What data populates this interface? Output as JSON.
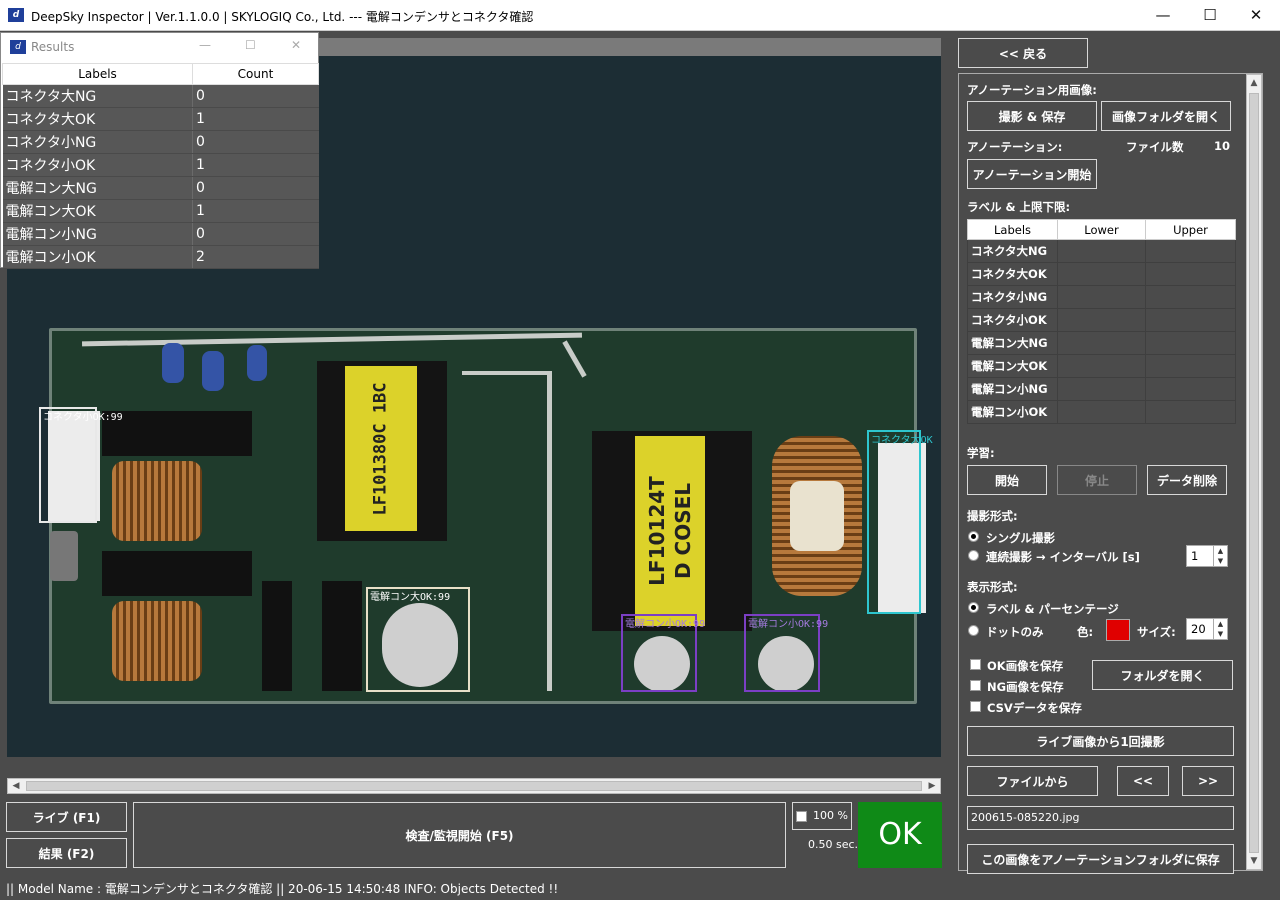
{
  "window": {
    "title": "DeepSky Inspector | Ver.1.1.0.0 | SKYLOGIQ Co., Ltd. --- 電解コンデンサとコネクタ確認",
    "minimize": "—",
    "maximize": "☐",
    "close": "✕"
  },
  "results": {
    "title": "Results",
    "headers": {
      "labels": "Labels",
      "count": "Count"
    },
    "rows": [
      {
        "label": "コネクタ大NG",
        "count": "0"
      },
      {
        "label": "コネクタ大OK",
        "count": "1"
      },
      {
        "label": "コネクタ小NG",
        "count": "0"
      },
      {
        "label": "コネクタ小OK",
        "count": "1"
      },
      {
        "label": "電解コン大NG",
        "count": "0"
      },
      {
        "label": "電解コン大OK",
        "count": "1"
      },
      {
        "label": "電解コン小NG",
        "count": "0"
      },
      {
        "label": "電解コン小OK",
        "count": "2"
      }
    ]
  },
  "detections": [
    {
      "label": "コネクタ小OK:99",
      "color": "#e8e8e8"
    },
    {
      "label": "コネクタ大OK",
      "color": "#2ec6cf"
    },
    {
      "label": "電解コン大OK:99",
      "color": "#e8e0c8"
    },
    {
      "label": "電解コン小OK:99",
      "color": "#7b3fc4"
    },
    {
      "label": "電解コン小OK:99",
      "color": "#7b3fc4"
    }
  ],
  "board_print": {
    "coil1": "LF101380C 1BC",
    "coil2a": "LF10124T",
    "coil2b": "D COSEL"
  },
  "controls": {
    "live": "ライブ (F1)",
    "result": "結果 (F2)",
    "inspect": "検査/監視開始 (F5)",
    "zoom": "100 %",
    "time": "0.50 sec.",
    "verdict": "OK",
    "verdict_color": "#0f8a17"
  },
  "panel": {
    "back": "<< 戻る",
    "annot_image": "アノーテーション用画像:",
    "shoot_save": "撮影 & 保存",
    "open_img_folder": "画像フォルダを開く",
    "annotation": "アノーテーション:",
    "file_count_label": "ファイル数",
    "file_count": "10",
    "annot_start": "アノーテーション開始",
    "label_limits": "ラベル & 上限下限:",
    "lim_headers": {
      "labels": "Labels",
      "lower": "Lower",
      "upper": "Upper"
    },
    "lim_rows": [
      "コネクタ大NG",
      "コネクタ大OK",
      "コネクタ小NG",
      "コネクタ小OK",
      "電解コン大NG",
      "電解コン大OK",
      "電解コン小NG",
      "電解コン小OK"
    ],
    "learning": "学習:",
    "start": "開始",
    "stop": "停止",
    "delete_data": "データ削除",
    "shoot_mode": "撮影形式:",
    "single": "シングル撮影",
    "continuous": "連続撮影 → インターバル [s]",
    "interval": "1",
    "display_mode": "表示形式:",
    "label_pct": "ラベル & パーセンテージ",
    "dot_only": "ドットのみ",
    "color_label": "色:",
    "dot_color": "#e00000",
    "size_label": "サイズ:",
    "size": "20",
    "save_ok": "OK画像を保存",
    "save_ng": "NG画像を保存",
    "save_csv": "CSVデータを保存",
    "open_folder": "フォルダを開く",
    "one_shot": "ライブ画像から1回撮影",
    "from_file": "ファイルから",
    "prev": "<<",
    "next": ">>",
    "filename": "200615-085220.jpg",
    "save_to_annot": "この画像をアノーテーションフォルダに保存"
  },
  "status": "|| Model Name : 電解コンデンサとコネクタ確認 ||    20-06-15 14:50:48   INFO:   Objects Detected !!"
}
